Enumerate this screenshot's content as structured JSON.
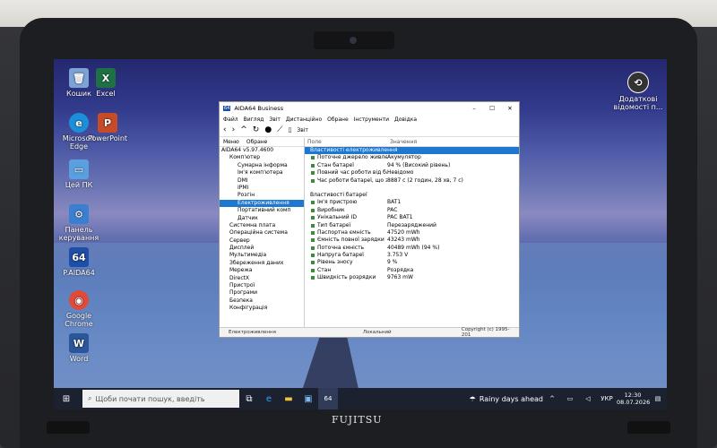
{
  "desktop_icons": [
    {
      "label": "Кошик",
      "icon": "recycle-bin-icon",
      "color": "#7da2d6"
    },
    {
      "label": "Excel",
      "icon": "excel-icon",
      "color": "#1d7145"
    },
    {
      "label": "Microsoft Edge",
      "icon": "edge-icon",
      "color": "#1b8fd8"
    },
    {
      "label": "PowerPoint",
      "icon": "powerpoint-icon",
      "color": "#c64b28"
    },
    {
      "label": "Цей ПК",
      "icon": "this-pc-icon",
      "color": "#5aa0e0"
    },
    {
      "label": "Панель керування",
      "icon": "control-panel-icon",
      "color": "#3b7fd0"
    },
    {
      "label": "P.AIDA64",
      "icon": "aida64-icon",
      "color": "#1d4fa6"
    },
    {
      "label": "Google Chrome",
      "icon": "chrome-icon",
      "color": "#e04a3a"
    },
    {
      "label": "Word",
      "icon": "word-icon",
      "color": "#2b579a"
    },
    {
      "label": "Додаткові відомості п...",
      "icon": "info-icon",
      "color": "#333333"
    }
  ],
  "window": {
    "title": "AIDA64 Business",
    "title_icon": "64",
    "menu": [
      "Файл",
      "Вигляд",
      "Звіт",
      "Дистанційно",
      "Обране",
      "Інструменти",
      "Довідка"
    ],
    "report_button": "Звіт",
    "tabs": [
      "Меню",
      "Обране"
    ],
    "tree": [
      {
        "label": "AIDA64 v5.97.4600",
        "level": 0
      },
      {
        "label": "Комп'ютер",
        "level": 1
      },
      {
        "label": "Сумарна інформа",
        "level": 2
      },
      {
        "label": "Ім'я комп'ютера",
        "level": 2
      },
      {
        "label": "DMI",
        "level": 2
      },
      {
        "label": "IPMI",
        "level": 2
      },
      {
        "label": "Розгін",
        "level": 2
      },
      {
        "label": "Електроживлення",
        "level": 2,
        "selected": true
      },
      {
        "label": "Портативний комп",
        "level": 2
      },
      {
        "label": "Датчик",
        "level": 2
      },
      {
        "label": "Системна плата",
        "level": 1
      },
      {
        "label": "Операційна система",
        "level": 1
      },
      {
        "label": "Сервер",
        "level": 1
      },
      {
        "label": "Дисплей",
        "level": 1
      },
      {
        "label": "Мультимедіа",
        "level": 1
      },
      {
        "label": "Збереження даних",
        "level": 1
      },
      {
        "label": "Мережа",
        "level": 1
      },
      {
        "label": "DirectX",
        "level": 1
      },
      {
        "label": "Пристрої",
        "level": 1
      },
      {
        "label": "Програми",
        "level": 1
      },
      {
        "label": "Безпека",
        "level": 1
      },
      {
        "label": "Конфігурація",
        "level": 1
      }
    ],
    "col_field": "Поле",
    "col_value": "Значення",
    "sections": [
      {
        "title": "Властивості електроживлення",
        "highlight": true,
        "rows": [
          {
            "f": "Поточне джерело живлення",
            "v": "Акумулятор"
          },
          {
            "f": "Стан батареї",
            "v": "94 % (Високий рівень)"
          },
          {
            "f": "Повний час роботи від батареї",
            "v": "Невідомо"
          },
          {
            "f": "Час роботи батареї, що залиш...",
            "v": "8887 с (2 годин, 28 хв, 7 с)"
          }
        ]
      },
      {
        "title": "Властивості батареї",
        "highlight": false,
        "rows": [
          {
            "f": "Ім'я пристрою",
            "v": "BAT1"
          },
          {
            "f": "Виробник",
            "v": "PAC"
          },
          {
            "f": "Унікальний ID",
            "v": "PAC BAT1"
          },
          {
            "f": "Тип батареї",
            "v": "Перезаряджений"
          },
          {
            "f": "Паспортна ємність",
            "v": "47520 mWh"
          },
          {
            "f": "Ємність повної зарядки",
            "v": "43243 mWh"
          },
          {
            "f": "Поточна ємність",
            "v": "40489 mWh  (94 %)"
          },
          {
            "f": "Напруга батареї",
            "v": "3.753 V"
          },
          {
            "f": "Рівень зносу",
            "v": "9 %"
          },
          {
            "f": "Стан",
            "v": "Розрядка"
          },
          {
            "f": "Швидкість розрядки",
            "v": "9763 mW"
          }
        ]
      }
    ],
    "status_left": "Електроживлення",
    "status_mid": "Локальний",
    "status_right": "Copyright (c) 1995-201"
  },
  "taskbar": {
    "search_placeholder": "Щоби почати пошук, введіть",
    "weather": "Rainy days ahead",
    "lang": "УКР",
    "time": "12:30",
    "date": "08.07.2026"
  },
  "brand": "FUJITSU",
  "colors": {
    "accent": "#1e78d0",
    "taskbar": "#1c2130"
  }
}
